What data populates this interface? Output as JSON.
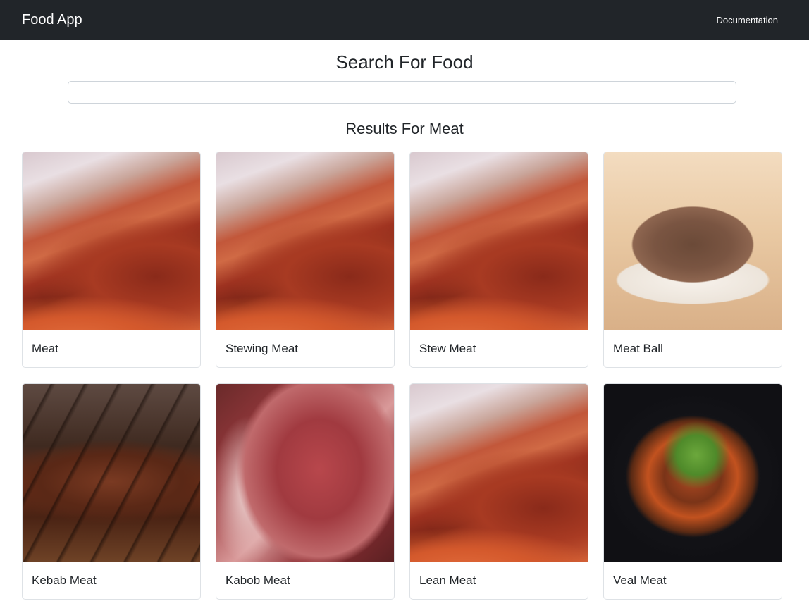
{
  "navbar": {
    "brand": "Food App",
    "documentation_link": "Documentation"
  },
  "page": {
    "title": "Search For Food",
    "search_value": "",
    "results_title": "Results For Meat"
  },
  "results": [
    {
      "name": "Meat",
      "image": "raw-meat"
    },
    {
      "name": "Stewing Meat",
      "image": "raw-meat"
    },
    {
      "name": "Stew Meat",
      "image": "raw-meat"
    },
    {
      "name": "Meat Ball",
      "image": "ground-meat"
    },
    {
      "name": "Kebab Meat",
      "image": "grilled-kebab"
    },
    {
      "name": "Kabob Meat",
      "image": "raw-steak"
    },
    {
      "name": "Lean Meat",
      "image": "raw-meat"
    },
    {
      "name": "Veal Meat",
      "image": "veal-stew"
    }
  ],
  "colors": {
    "navbar_bg": "#212529",
    "card_border": "#dee2e6"
  }
}
